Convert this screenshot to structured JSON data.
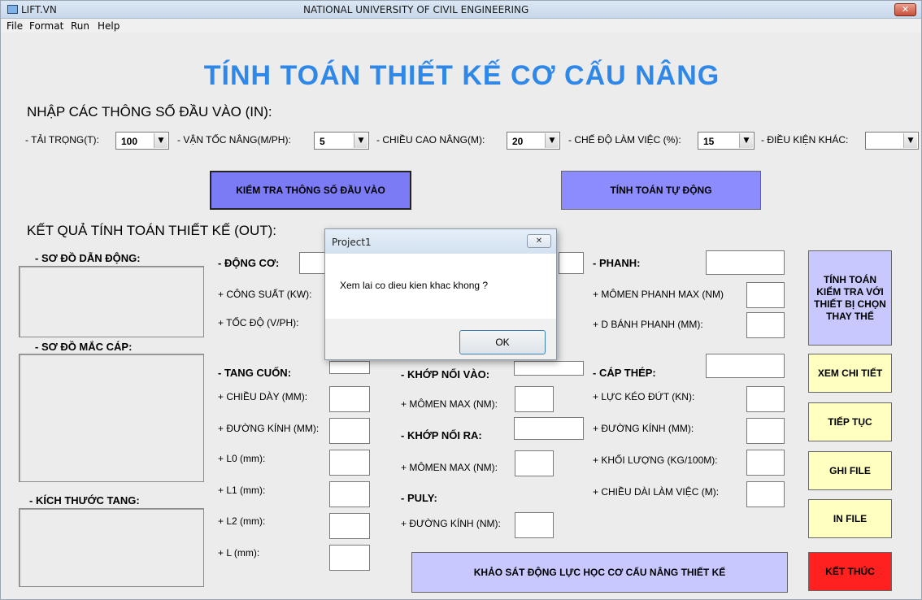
{
  "window": {
    "app_name": "LIFT.VN",
    "title": "NATIONAL UNIVERSITY OF CIVIL ENGINEERING",
    "close_glyph": "✕"
  },
  "menu": [
    "File",
    "Format",
    "Run",
    "Help"
  ],
  "heading": "TÍNH TOÁN THIẾT KẾ CƠ CẤU NÂNG",
  "input_section": {
    "title": "NHẬP CÁC THÔNG SỐ ĐẦU VÀO (IN):",
    "load_label": "- TẢI TRỌNG(T):",
    "load_value": "100",
    "speed_label": "- VẬN TỐC NÂNG(M/PH):",
    "speed_value": "5",
    "height_label": "- CHIỀU CAO NÂNG(M):",
    "height_value": "20",
    "duty_label": "- CHẾ ĐỘ LÀM VIỆC (%):",
    "duty_value": "15",
    "other_label": "- ĐIỀU KIỆN KHÁC:",
    "other_value": "",
    "check_button": "KIỂM TRA THÔNG SỐ ĐẦU VÀO",
    "auto_button": "TÍNH TOÁN TỰ ĐỘNG"
  },
  "output_section": {
    "title": "KẾT QUẢ TÍNH TOÁN THIẾT KẾ (OUT):",
    "drive_diagram": "- SƠ ĐỒ DẪN ĐỘNG:",
    "cable_diagram": "- SƠ ĐỒ MẮC CÁP:",
    "drum_size": "- KÍCH THƯỚC TANG:",
    "motor": "- ĐỘNG CƠ:",
    "power": "+ CÔNG SUẤT (KW):",
    "speed": "+ TỐC ĐỘ (V/PH):",
    "drum": "- TANG CUỐN:",
    "thickness": "+ CHIỀU DÀY (MM):",
    "drum_diameter": "+ ĐƯỜNG KÍNH (MM):",
    "l0": "+ L0 (mm):",
    "l1": "+ L1 (mm):",
    "l2": "+ L2 (mm):",
    "l": "+ L (mm):",
    "coupling_in": "- KHỚP NỐI VÀO:",
    "torque_in": "+ MÔMEN MAX (NM):",
    "coupling_out": "- KHỚP NỐI RA:",
    "torque_out": "+ MÔMEN MAX (NM):",
    "pulley": "- PULY:",
    "pulley_diameter": "+ ĐƯỜNG KÍNH (NM):",
    "brake": "- PHANH:",
    "brake_torque": "+ MÔMEN PHANH MAX (NM)",
    "brake_wheel": "+ D BÁNH PHANH (MM):",
    "cable": "- CÁP THÉP:",
    "breaking_force": "+ LỰC KÉO ĐỨT (KN):",
    "cable_diameter": "+ ĐƯỜNG KÍNH (MM):",
    "mass": "+ KHỐI LƯỢNG (KG/100M):",
    "working_length": "+ CHIỀU DÀI LÀM VIỆC (M):"
  },
  "side_buttons": {
    "recheck": "TÍNH TOÁN KIỂM TRA VỚI THIẾT BỊ CHỌN THAY THẾ",
    "detail": "XEM CHI TIẾT",
    "continue": "TIẾP TỤC",
    "save": "GHI FILE",
    "print": "IN FILE",
    "exit": "KẾT THÚC"
  },
  "dynamics_button": "KHẢO SÁT ĐỘNG LỰC HỌC  CƠ CẤU NÂNG THIẾT KẾ",
  "dialog": {
    "title": "Project1",
    "close_glyph": "✕",
    "message": "Xem lai co dieu kien khac khong ?",
    "ok": "OK"
  },
  "colors": {
    "heading": "#2f87e8",
    "check_button": "#7b7bf5",
    "auto_button": "#8c8cff",
    "recheck_button": "#c8c8ff",
    "yellow_button": "#ffffc0",
    "exit_button": "#ff2020"
  }
}
